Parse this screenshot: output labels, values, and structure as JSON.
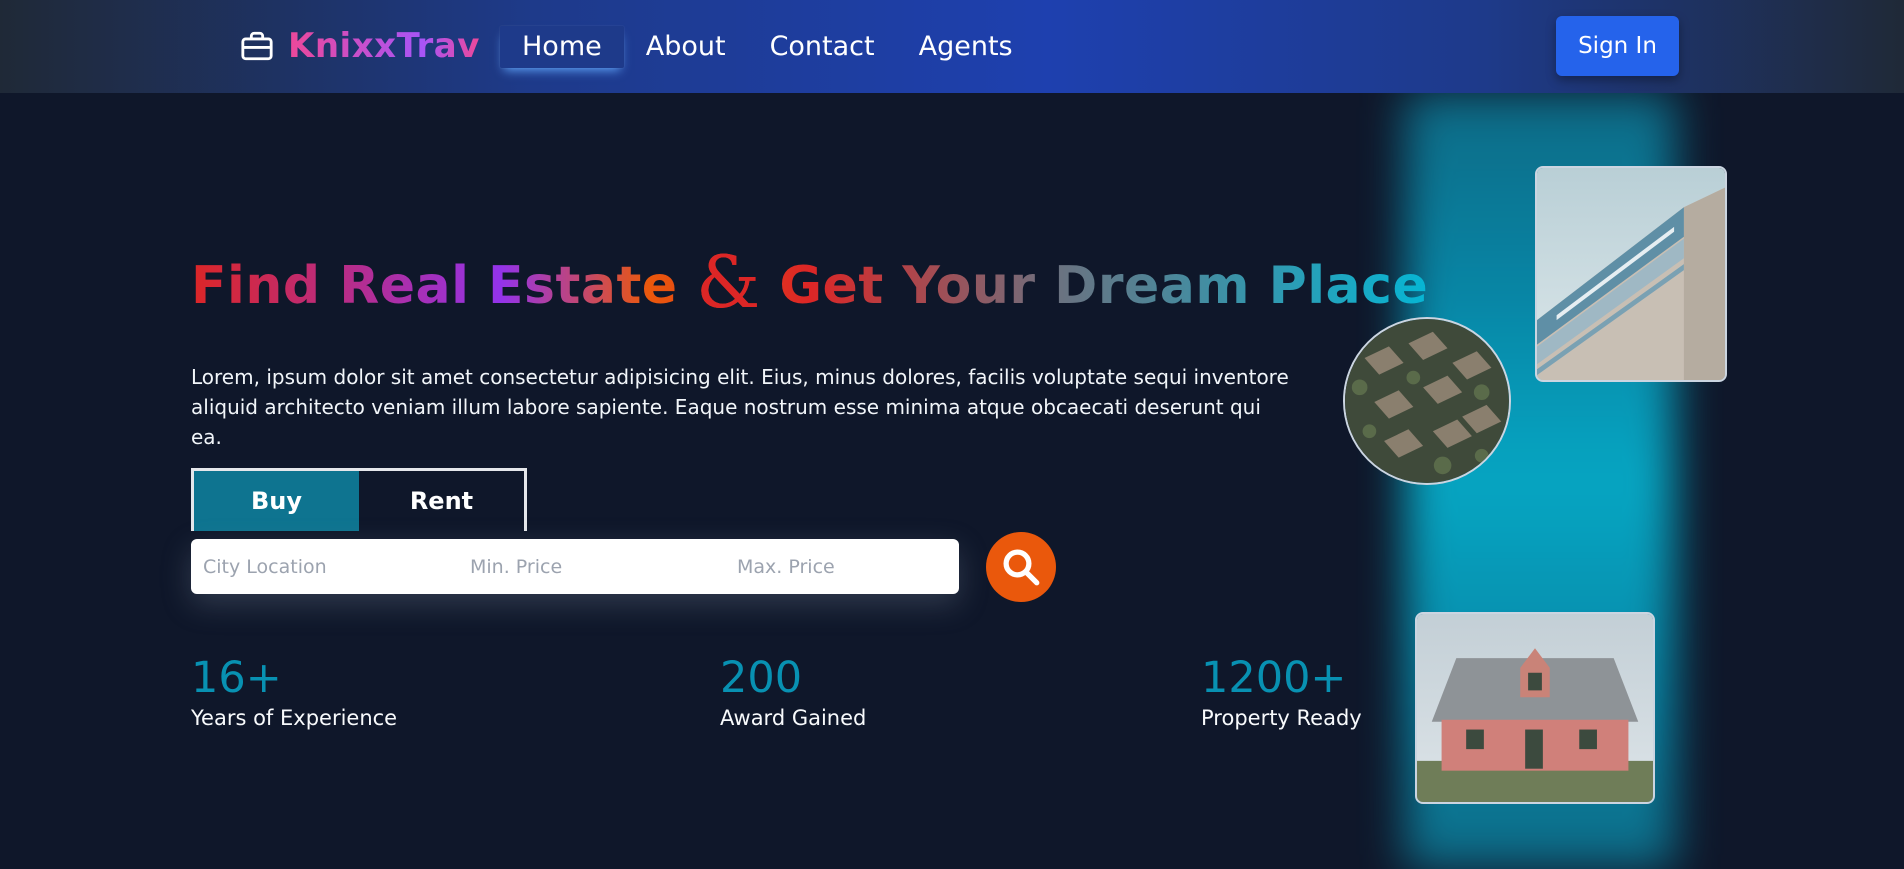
{
  "nav": {
    "brand": "KnixxTrav",
    "brand_icon": "briefcase-icon",
    "links": [
      {
        "label": "Home",
        "active": true
      },
      {
        "label": "About",
        "active": false
      },
      {
        "label": "Contact",
        "active": false
      },
      {
        "label": "Agents",
        "active": false
      }
    ],
    "signin_label": "Sign In"
  },
  "hero": {
    "title_part1": "Find Real Estate ",
    "title_amp": "&",
    "title_part2": " Get Your Dream Place",
    "description": "Lorem, ipsum dolor sit amet consectetur adipisicing elit. Eius, minus dolores, facilis voluptate sequi inventore aliquid architecto veniam illum labore sapiente. Eaque nostrum esse minima atque obcaecati deserunt qui ea."
  },
  "tabs": [
    {
      "label": "Buy",
      "active": true
    },
    {
      "label": "Rent",
      "active": false
    }
  ],
  "search": {
    "city_placeholder": "City Location",
    "min_price_placeholder": "Min. Price",
    "max_price_placeholder": "Max. Price",
    "button_icon": "search-icon"
  },
  "stats": [
    {
      "value": "16+",
      "label": "Years of Experience"
    },
    {
      "value": "200",
      "label": "Award Gained"
    },
    {
      "value": "1200+",
      "label": "Property Ready"
    }
  ],
  "images": {
    "building": "modern-building-photo",
    "houses": "aerial-houses-photo",
    "house": "pink-farmhouse-photo"
  },
  "colors": {
    "background": "#0f172a",
    "accent_teal": "#0891b2",
    "tab_active": "#0e7490",
    "search_button": "#ea580c",
    "signin_button": "#2563eb"
  }
}
